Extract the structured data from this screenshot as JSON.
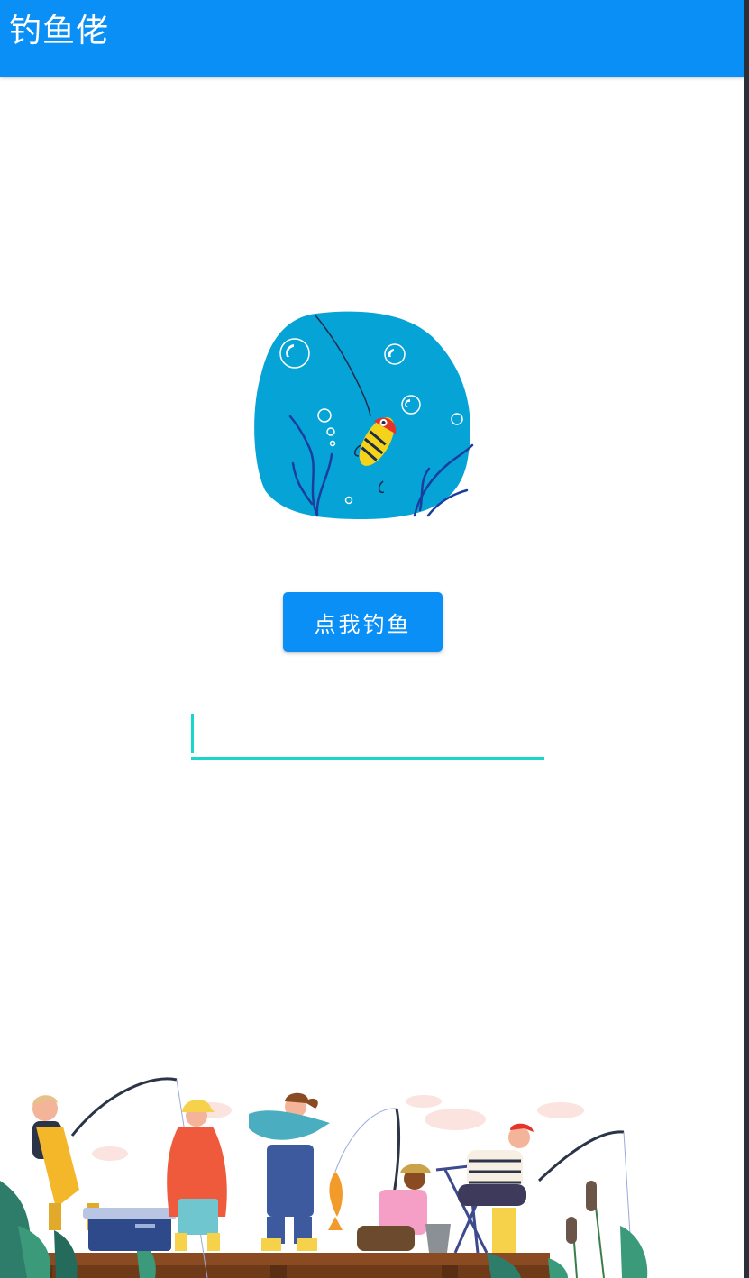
{
  "app": {
    "title": "钓鱼佬"
  },
  "hero": {
    "icon": "fishing-lure-underwater-illustration"
  },
  "main": {
    "fish_button_label": "点我钓鱼",
    "result_input_value": ""
  },
  "footer": {
    "illustration": "people-fishing-on-pier-illustration"
  },
  "colors": {
    "primary": "#0a8ff7",
    "water": "#06a3d6",
    "input_accent": "#1ad6c8"
  }
}
